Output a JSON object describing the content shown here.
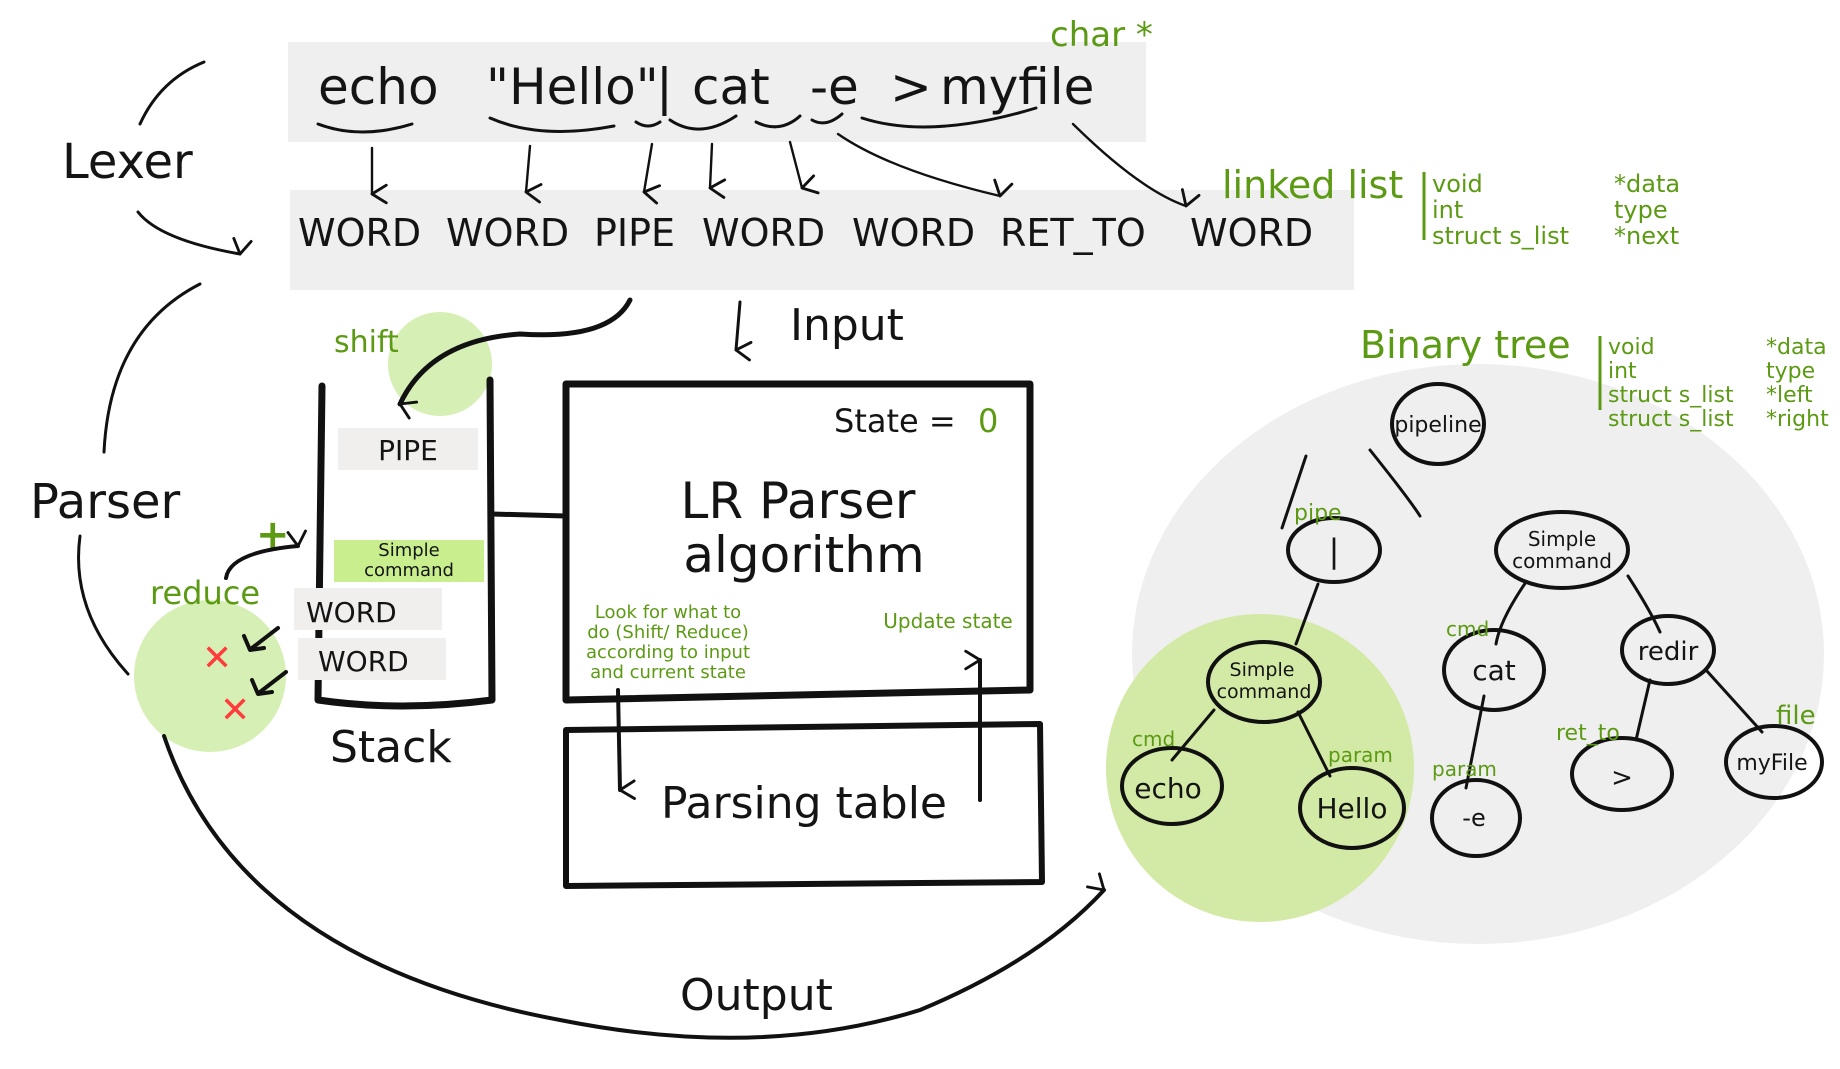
{
  "colors": {
    "accent_green": "#5c9a14",
    "highlight_green": "#d6efb4",
    "highlight_green_box": "#c9ee8e",
    "panel_gray": "#efefef",
    "token_box_gray": "#f0efee",
    "cross_red": "#ff3b3b",
    "ink": "#141414"
  },
  "lexer": {
    "label": "Lexer",
    "command_tokens": [
      "echo",
      "\"Hello\"",
      "|",
      "cat",
      "-e",
      ">",
      "myfile"
    ],
    "char_annotation": "char *",
    "token_types": [
      "WORD",
      "WORD",
      "PIPE",
      "WORD",
      "WORD",
      "RET_TO",
      "WORD"
    ],
    "linked_list": {
      "label": "linked list",
      "fields": [
        {
          "type": "void",
          "name": "*data"
        },
        {
          "type": "int",
          "name": "type"
        },
        {
          "type": "struct s_list",
          "name": "*next"
        }
      ]
    }
  },
  "parser": {
    "label": "Parser",
    "input_label": "Input",
    "output_label": "Output",
    "shift_label": "shift",
    "reduce_label": "reduce",
    "plus_symbol": "+",
    "cross_symbol": "✕",
    "stack": {
      "label": "Stack",
      "items": [
        "PIPE",
        "Simple command",
        "WORD",
        "WORD"
      ]
    },
    "lr_box": {
      "state_label": "State =",
      "state_value": "0",
      "title_line1": "LR Parser",
      "title_line2": "algorithm",
      "note_left": [
        "Look for what to",
        "do (Shift/ Reduce)",
        "according to input",
        "and current state"
      ],
      "note_right": "Update state"
    },
    "parsing_table": {
      "label": "Parsing table"
    }
  },
  "tree": {
    "label": "Binary tree",
    "fields": [
      {
        "type": "void",
        "name": "*data"
      },
      {
        "type": "int",
        "name": "type"
      },
      {
        "type": "struct s_list",
        "name": "*left"
      },
      {
        "type": "struct s_list",
        "name": "*right"
      }
    ],
    "nodes": {
      "pipeline": "pipeline",
      "pipe": "|",
      "sc_right": [
        "Simple",
        "command"
      ],
      "sc_left": [
        "Simple",
        "command"
      ],
      "echo": "echo",
      "hello": "Hello",
      "cat": "cat",
      "e_flag": "-e",
      "redir": "redir",
      "gt": ">",
      "myfile": "myFile"
    },
    "edge_labels": {
      "pipe": "pipe",
      "cmd_echo": "cmd",
      "param_hello": "param",
      "cmd_cat": "cmd",
      "param_e": "param",
      "ret_to": "ret_to",
      "file": "file"
    }
  }
}
